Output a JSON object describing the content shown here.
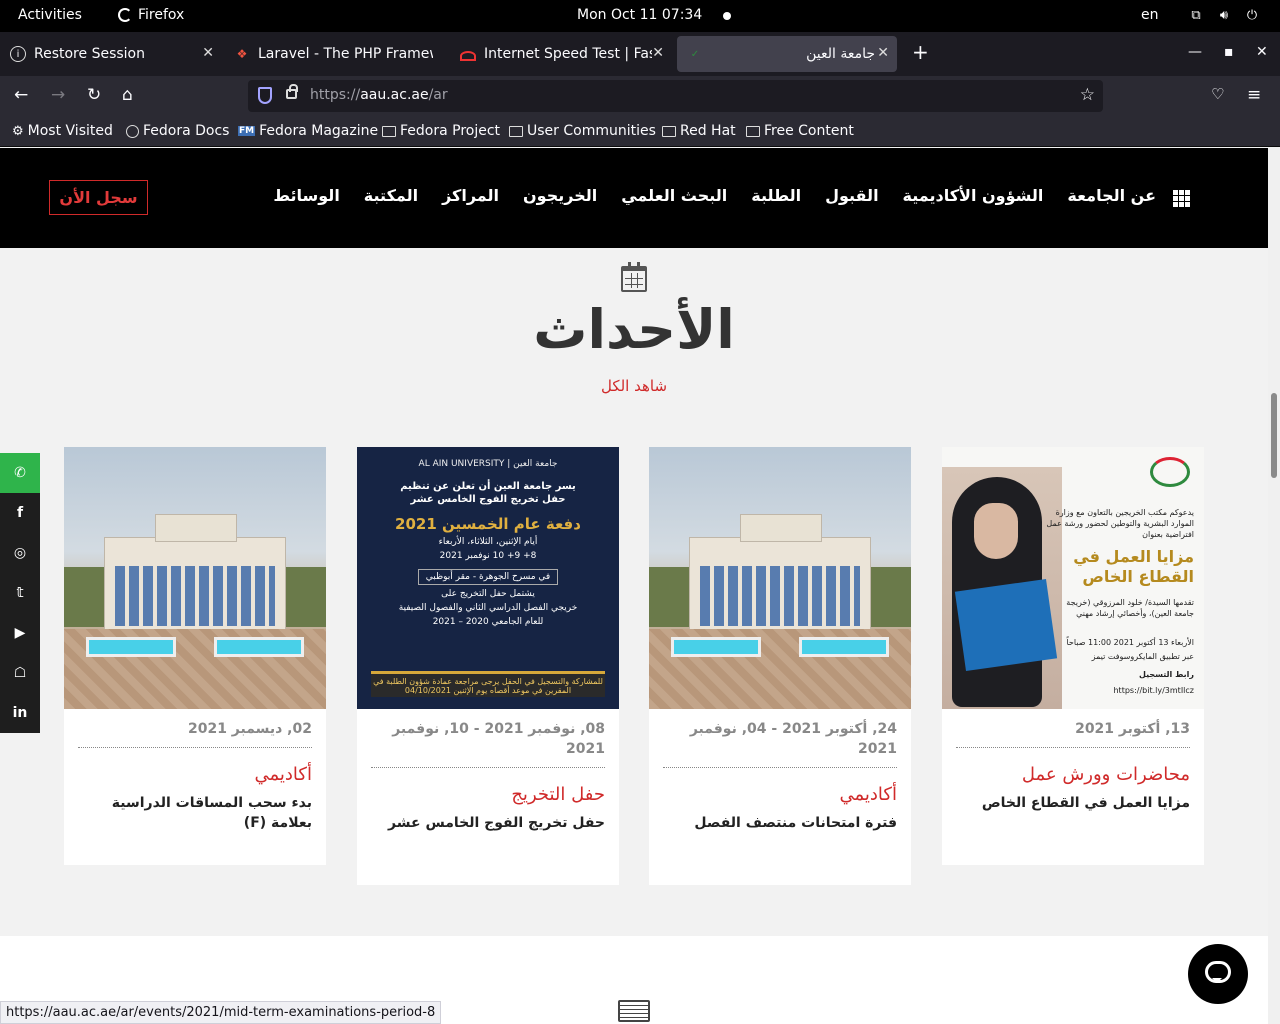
{
  "gnome": {
    "activities": "Activities",
    "app_name": "Firefox",
    "clock": "Mon Oct 11  07:34",
    "lang": "en"
  },
  "tabs": [
    {
      "label": "Restore Session",
      "icon": "info-icon"
    },
    {
      "label": "Laravel - The PHP Framew",
      "icon": "laravel-icon"
    },
    {
      "label": "Internet Speed Test | Fast",
      "icon": "speedometer-icon"
    },
    {
      "label": "جامعة العين",
      "icon": "site-favicon",
      "active": true
    }
  ],
  "url": {
    "prefix": "https://",
    "host": "aau.ac.ae",
    "path": "/ar"
  },
  "bookmarks": [
    "Most Visited",
    "Fedora Docs",
    "Fedora Magazine",
    "Fedora Project",
    "User Communities",
    "Red Hat",
    "Free Content"
  ],
  "site": {
    "register": "سجل الأن",
    "menu": [
      "عن الجامعة",
      "الشؤون الأكاديمية",
      "القبول",
      "الطلبة",
      "البحث العلمي",
      "الخريجون",
      "المراكز",
      "المكتبة",
      "الوسائط"
    ]
  },
  "events": {
    "title": "الأحداث",
    "see_all": "شاهد الكل",
    "cards": [
      {
        "date": "13, أكتوبر 2021",
        "category": "محاضرات وورش عمل",
        "title": "مزايا العمل في القطاع الخاص"
      },
      {
        "date": "24, أكتوبر 2021 - 04, نوفمبر 2021",
        "category": "أكاديمي",
        "title": "فترة امتحانات منتصف الفصل"
      },
      {
        "date": "08, نوفمبر 2021 - 10, نوفمبر 2021",
        "category": "حفل التخريج",
        "title": "حفل تخريج الفوج الخامس عشر"
      },
      {
        "date": "02, ديسمبر 2021",
        "category": "أكاديمي",
        "title": "بدء سحب المساقات الدراسية بعلامة (F)"
      }
    ]
  },
  "poster_grad": {
    "logos": "جامعة العين  |  AL AIN UNIVERSITY",
    "line1": "يسر جامعة العين أن تعلن عن تنظيم",
    "line2": "حفل تخريج الفوج الخامس عشر",
    "big": "دفعة عام الخمسين 2021",
    "days": "أيام الإثنين، الثلاثاء، الأربعاء",
    "dates": "8+ 9+ 10 نوفمبر 2021",
    "venue": "في مسرح الجوهرة - مقر أبوظبي",
    "l3": "يشتمل حفل التخريج على",
    "l4": "خريجي الفصل الدراسي الثاني والفصول الصيفية",
    "l5": "للعام الجامعي 2020 – 2021",
    "footer": "للمشاركة والتسجيل في الحفل يرجى مراجعة عمادة شؤون الطلبة في المقرين في موعد أقصاه يوم الإثنين 04/10/2021"
  },
  "poster_work": {
    "intro": "يدعوكم مكتب الخريجين بالتعاون مع وزارة الموارد البشرية والتوطين لحضور ورشة عمل افتراضية بعنوان",
    "title": "مزايا العمل في القطاع الخاص",
    "presenter": "تقدمها السيدة/ خلود المرزوقي (خريجة جامعة العين)، وأخصائي إرشاد مهني",
    "when": "الأربعاء 13 أكتوبر 2021  11:00 صباحاً",
    "where": "عبر تطبيق المايكروسوفت تيمز",
    "reg": "رابط التسجيل",
    "link": "https://bit.ly/3mtIlcz"
  },
  "status_url": "https://aau.ac.ae/ar/events/2021/mid-term-examinations-period-8"
}
